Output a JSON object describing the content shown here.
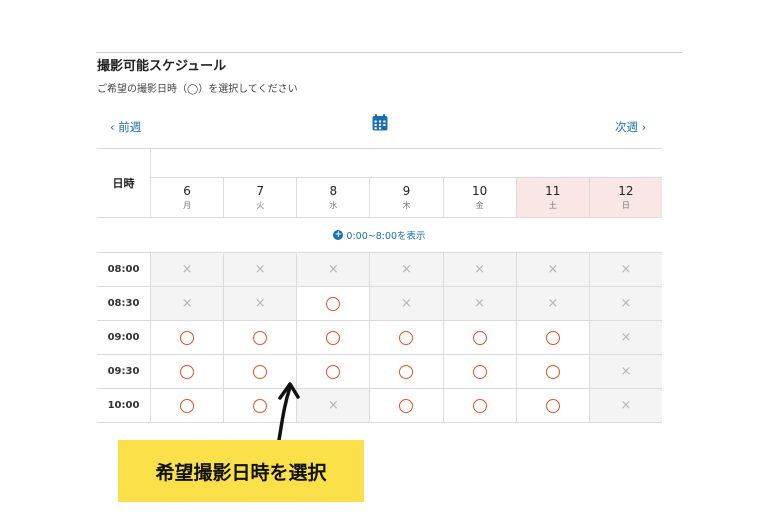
{
  "title": "撮影可能スケジュール",
  "subtitle": "ご希望の撮影日時（◯）を選択してください",
  "nav": {
    "prev": "‹ 前週",
    "next": "次週 ›",
    "calendar_icon": "calendar-icon"
  },
  "header_label": "日時",
  "days": [
    {
      "num": "6",
      "wd": "月",
      "weekend": false
    },
    {
      "num": "7",
      "wd": "火",
      "weekend": false
    },
    {
      "num": "8",
      "wd": "水",
      "weekend": false
    },
    {
      "num": "9",
      "wd": "木",
      "weekend": false
    },
    {
      "num": "10",
      "wd": "金",
      "weekend": false
    },
    {
      "num": "11",
      "wd": "土",
      "weekend": true
    },
    {
      "num": "12",
      "wd": "日",
      "weekend": true
    }
  ],
  "show_more": "0:00~8:00を表示",
  "rows": [
    {
      "time": "08:00",
      "slots": [
        "x",
        "x",
        "x",
        "x",
        "x",
        "x",
        "x"
      ]
    },
    {
      "time": "08:30",
      "slots": [
        "x",
        "x",
        "o",
        "x",
        "x",
        "x",
        "x"
      ]
    },
    {
      "time": "09:00",
      "slots": [
        "o",
        "o",
        "o",
        "o",
        "o",
        "o",
        "x"
      ]
    },
    {
      "time": "09:30",
      "slots": [
        "o",
        "o",
        "o",
        "o",
        "o",
        "o",
        "x"
      ]
    },
    {
      "time": "10:00",
      "slots": [
        "o",
        "o",
        "x",
        "o",
        "o",
        "o",
        "x"
      ]
    }
  ],
  "unavailable_mark": "×",
  "callout": "希望撮影日時を選択",
  "colors": {
    "accent": "#1a6fb3",
    "available": "#e0552b",
    "weekend": "#fbe6e6",
    "callout": "#fbe049"
  }
}
